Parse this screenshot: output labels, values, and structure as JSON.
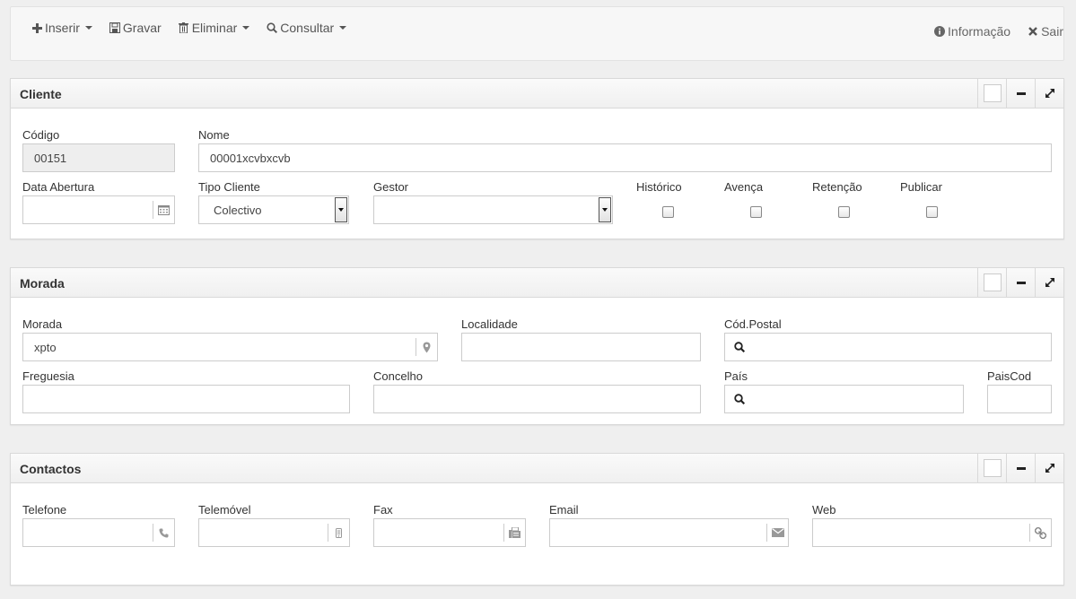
{
  "toolbar": {
    "insert": "Inserir",
    "save": "Gravar",
    "delete": "Eliminar",
    "query": "Consultar",
    "info": "Informação",
    "exit": "Sair"
  },
  "cliente": {
    "title": "Cliente",
    "codigo_label": "Código",
    "codigo_value": "00151",
    "nome_label": "Nome",
    "nome_value": "00001xcvbxcvb",
    "data_label": "Data Abertura",
    "data_value": "",
    "tipo_label": "Tipo Cliente",
    "tipo_value": "Colectivo",
    "gestor_label": "Gestor",
    "gestor_value": "",
    "historico_label": "Histórico",
    "avenca_label": "Avença",
    "retencao_label": "Retenção",
    "publicar_label": "Publicar"
  },
  "morada": {
    "title": "Morada",
    "morada_label": "Morada",
    "morada_value": "xpto",
    "localidade_label": "Localidade",
    "codpostal_label": "Cód.Postal",
    "freguesia_label": "Freguesia",
    "concelho_label": "Concelho",
    "pais_label": "País",
    "paiscod_label": "PaisCod"
  },
  "contactos": {
    "title": "Contactos",
    "telefone_label": "Telefone",
    "telemovel_label": "Telemóvel",
    "fax_label": "Fax",
    "email_label": "Email",
    "web_label": "Web"
  },
  "icons": {
    "insert": "plus-icon",
    "save": "floppy-icon",
    "delete": "trash-icon",
    "query": "zoom-icon",
    "info": "info-circle-icon",
    "exit": "close-icon"
  }
}
